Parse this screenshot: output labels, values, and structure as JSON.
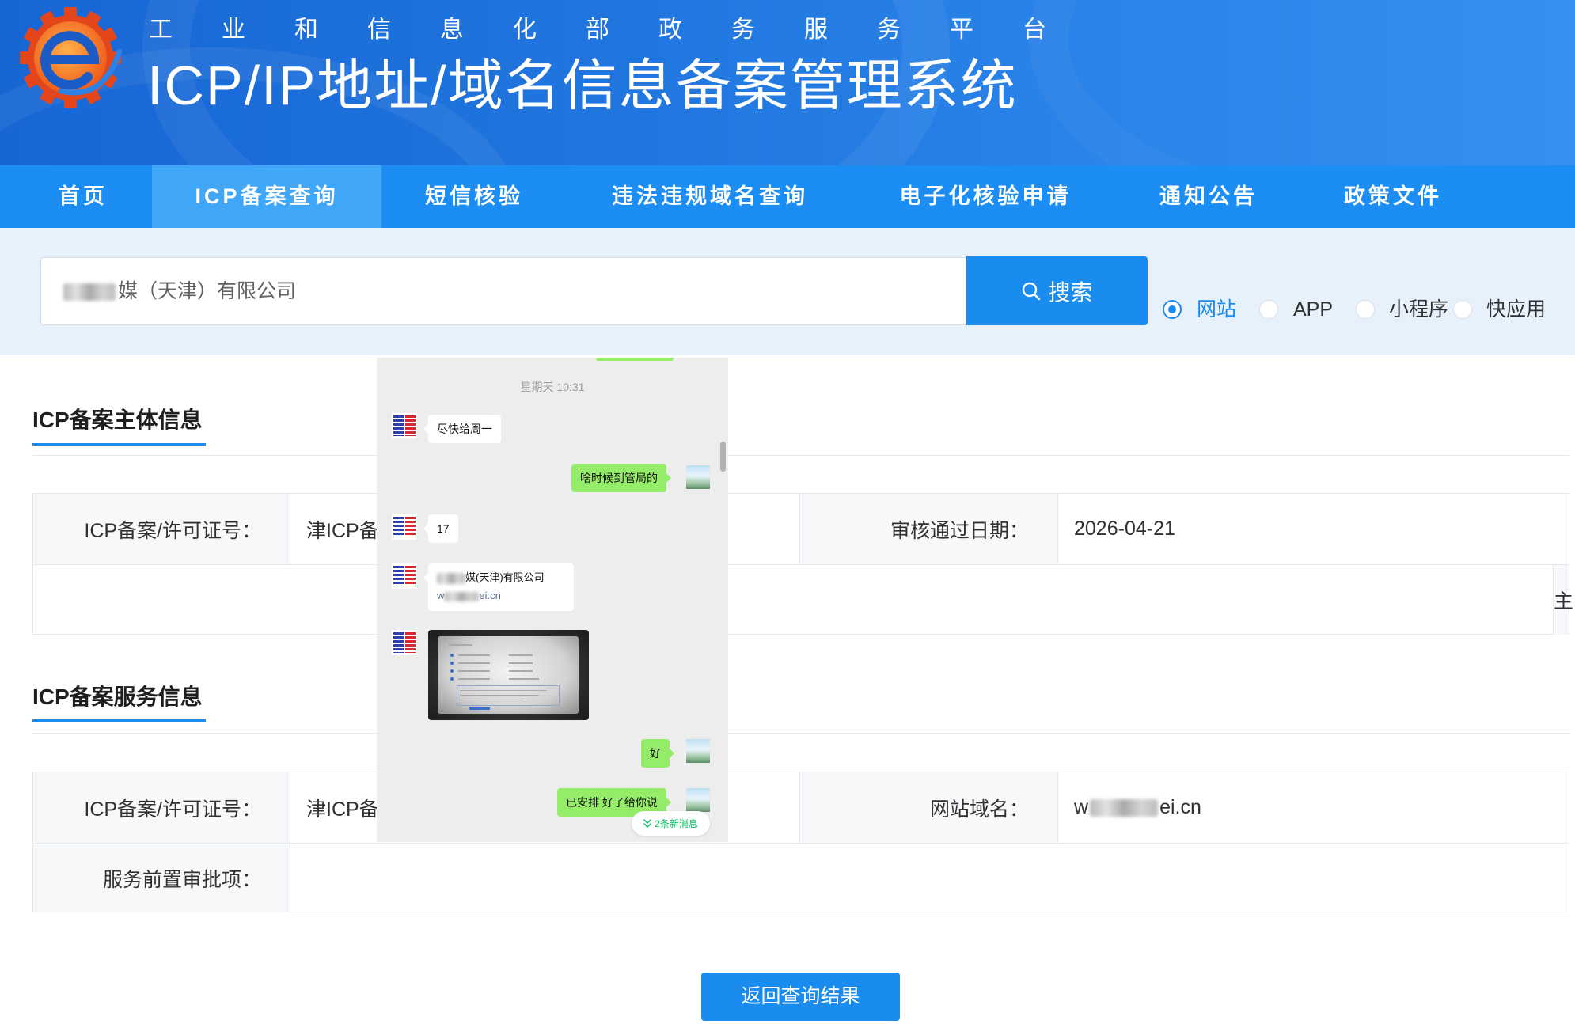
{
  "header": {
    "org": "工业和信息化部政务服务平台",
    "title": "ICP/IP地址/域名信息备案管理系统",
    "logo_icon": "gear-e-logo-icon"
  },
  "nav": {
    "items": [
      "首页",
      "ICP备案查询",
      "短信核验",
      "违法违规域名查询",
      "电子化核验申请",
      "通知公告",
      "政策文件"
    ],
    "active_index": 1
  },
  "search": {
    "query_visible": "媒（天津）有限公司",
    "button_label": "搜索",
    "button_icon": "search-icon",
    "types": [
      {
        "label": "网站",
        "checked": true
      },
      {
        "label": "APP",
        "checked": false
      },
      {
        "label": "小程序",
        "checked": false
      },
      {
        "label": "快应用",
        "checked": false
      }
    ]
  },
  "entity_section": {
    "title": "ICP备案主体信息",
    "license_label": "ICP备案/许可证号：",
    "license_value": "津ICP备",
    "approval_date_label": "审核通过日期：",
    "approval_date_value": "2026-04-21",
    "overflow_char": "主"
  },
  "service_section": {
    "title": "ICP备案服务信息",
    "license_label": "ICP备案/许可证号：",
    "license_value": "津ICP备",
    "domain_label": "网站域名：",
    "domain_value_prefix": "w",
    "domain_value_suffix": "ei.cn",
    "pre_approval_label": "服务前置审批项：",
    "pre_approval_value": ""
  },
  "back_button_label": "返回查询结果",
  "chat_overlay": {
    "timestamp": "星期天 10:31",
    "messages": [
      {
        "text": "尽快给周一"
      },
      {
        "text": "啥时候到管局的"
      },
      {
        "text": "17"
      },
      {
        "company_visible": "媒(天津)有限公司",
        "link_prefix": "w",
        "link_suffix": "ei.cn"
      },
      {
        "text": "好"
      },
      {
        "text": "已安排 好了给你说"
      }
    ],
    "image_message_icon": "photo-thumbnail-icon",
    "new_messages_label": "2条新消息",
    "new_messages_icon": "double-chevron-down-icon"
  },
  "colors": {
    "primary": "#1a8cf0",
    "nav_bg": "#1c8ef3",
    "nav_active": "#40a6f8",
    "search_area_bg": "#e7f1fb",
    "chat_green": "#95ec69",
    "chat_link": "#576b95",
    "new_messages": "#07c160"
  }
}
